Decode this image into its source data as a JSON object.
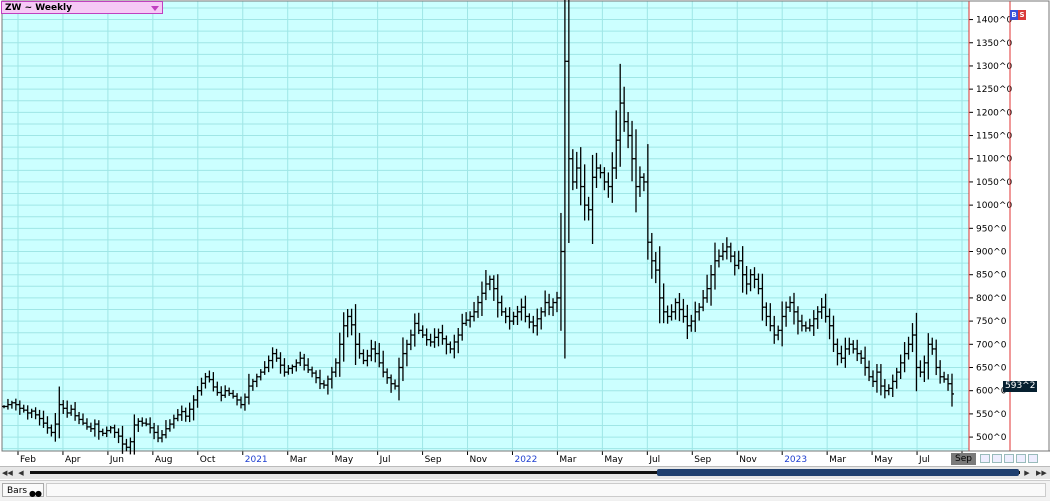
{
  "header": {
    "title": "ZW ~ Weekly",
    "dropdown_icon": "triangle-down-icon"
  },
  "toolbar": {
    "bs_b": "B",
    "bs_s": "S",
    "bars_label": "Bars"
  },
  "colors": {
    "plot_bg": "#ccffff",
    "grid": "#9fe6e6",
    "bars": "#000000",
    "border_red": "#e03030",
    "last_price_bg": "#062030"
  },
  "chart_data": {
    "type": "ohlc",
    "title": "ZW ~ Weekly",
    "frequency": "weekly",
    "last_value_label": "593^2",
    "ylim": [
      470,
      1440
    ],
    "y_ticks": [
      {
        "value": 1400,
        "label": "1400^0"
      },
      {
        "value": 1350,
        "label": "1350^0"
      },
      {
        "value": 1300,
        "label": "1300^0"
      },
      {
        "value": 1250,
        "label": "1250^0"
      },
      {
        "value": 1200,
        "label": "1200^0"
      },
      {
        "value": 1150,
        "label": "1150^0"
      },
      {
        "value": 1100,
        "label": "1100^0"
      },
      {
        "value": 1050,
        "label": "1050^0"
      },
      {
        "value": 1000,
        "label": "1000^0"
      },
      {
        "value": 950,
        "label": "950^0"
      },
      {
        "value": 900,
        "label": "900^0"
      },
      {
        "value": 850,
        "label": "850^0"
      },
      {
        "value": 800,
        "label": "800^0"
      },
      {
        "value": 750,
        "label": "750^0"
      },
      {
        "value": 700,
        "label": "700^0"
      },
      {
        "value": 650,
        "label": "650^0"
      },
      {
        "value": 600,
        "label": "600^0"
      },
      {
        "value": 550,
        "label": "550^0"
      },
      {
        "value": 500,
        "label": "500^0"
      }
    ],
    "x_ticks": [
      {
        "label": "Feb",
        "year": false
      },
      {
        "label": "Apr",
        "year": false
      },
      {
        "label": "Jun",
        "year": false
      },
      {
        "label": "Aug",
        "year": false
      },
      {
        "label": "Oct",
        "year": false
      },
      {
        "label": "2021",
        "year": true
      },
      {
        "label": "Mar",
        "year": false
      },
      {
        "label": "May",
        "year": false
      },
      {
        "label": "Jul",
        "year": false
      },
      {
        "label": "Sep",
        "year": false
      },
      {
        "label": "Nov",
        "year": false
      },
      {
        "label": "2022",
        "year": true
      },
      {
        "label": "Mar",
        "year": false
      },
      {
        "label": "May",
        "year": false
      },
      {
        "label": "Jul",
        "year": false
      },
      {
        "label": "Sep",
        "year": false
      },
      {
        "label": "Nov",
        "year": false
      },
      {
        "label": "2023",
        "year": true
      },
      {
        "label": "Mar",
        "year": false
      },
      {
        "label": "May",
        "year": false
      },
      {
        "label": "Jul",
        "year": false
      },
      {
        "label": "Sep",
        "year": false
      }
    ],
    "closes": [
      566,
      570,
      574,
      570,
      562,
      558,
      552,
      556,
      548,
      540,
      530,
      520,
      510,
      528,
      570,
      562,
      552,
      560,
      546,
      538,
      530,
      522,
      518,
      528,
      512,
      508,
      514,
      520,
      510,
      502,
      485,
      478,
      490,
      526,
      534,
      530,
      528,
      520,
      510,
      498,
      505,
      518,
      528,
      540,
      548,
      555,
      545,
      560,
      580,
      600,
      616,
      630,
      624,
      608,
      596,
      590,
      600,
      594,
      588,
      580,
      570,
      586,
      610,
      620,
      630,
      640,
      650,
      665,
      680,
      670,
      655,
      640,
      648,
      652,
      660,
      670,
      655,
      645,
      638,
      628,
      615,
      612,
      625,
      640,
      660,
      700,
      740,
      760,
      742,
      700,
      680,
      665,
      675,
      690,
      680,
      660,
      640,
      628,
      615,
      610,
      650,
      680,
      700,
      720,
      745,
      730,
      720,
      710,
      705,
      715,
      725,
      712,
      700,
      690,
      705,
      720,
      745,
      752,
      760,
      770,
      790,
      810,
      830,
      840,
      820,
      790,
      770,
      760,
      750,
      760,
      770,
      780,
      760,
      748,
      740,
      755,
      770,
      790,
      780,
      790,
      800,
      900,
      1310,
      1100,
      1050,
      1080,
      1040,
      1000,
      990,
      1060,
      1080,
      1070,
      1050,
      1040,
      1080,
      1140,
      1220,
      1180,
      1150,
      1100,
      1040,
      1060,
      1050,
      920,
      880,
      860,
      800,
      770,
      760,
      770,
      790,
      775,
      760,
      740,
      750,
      770,
      780,
      800,
      820,
      850,
      880,
      890,
      900,
      910,
      890,
      870,
      880,
      850,
      830,
      850,
      840,
      820,
      780,
      760,
      740,
      720,
      730,
      760,
      780,
      790,
      770,
      750,
      740,
      735,
      740,
      755,
      770,
      780,
      760,
      740,
      700,
      680,
      670,
      690,
      700,
      690,
      680,
      670,
      650,
      630,
      620,
      640,
      610,
      600,
      605,
      620,
      640,
      660,
      680,
      700,
      720,
      650,
      640,
      660,
      700,
      690,
      650,
      630,
      625,
      615,
      593
    ]
  }
}
